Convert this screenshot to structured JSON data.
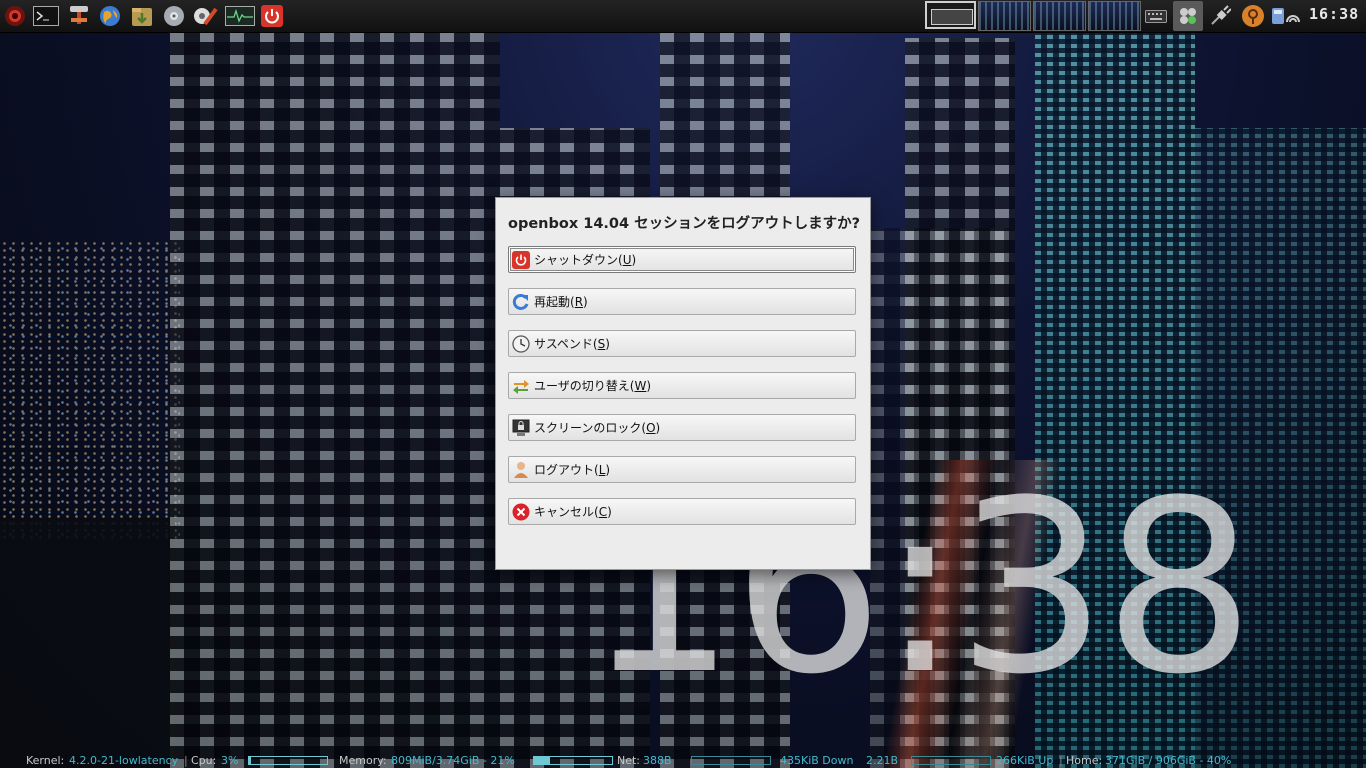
{
  "desktop": {
    "big_clock": "16:38"
  },
  "top_panel": {
    "launchers": [
      {
        "name": "menu-icon",
        "color": "#c8322b"
      },
      {
        "name": "terminal-icon",
        "color": "#333333"
      },
      {
        "name": "network-tools-icon",
        "color": "#c24a2a"
      },
      {
        "name": "web-browser-icon",
        "color": "#3d7bd0"
      },
      {
        "name": "file-manager-icon",
        "color": "#b99a52"
      },
      {
        "name": "disk-icon",
        "color": "#9aa0a8"
      },
      {
        "name": "settings-icon",
        "color": "#d24a2a"
      },
      {
        "name": "system-monitor-icon",
        "color": "#2d6a4a"
      },
      {
        "name": "power-icon",
        "color": "#d9342a"
      }
    ],
    "clock": "16:38"
  },
  "dialog": {
    "title": "openbox 14.04 セッションをログアウトしますか?",
    "options": [
      {
        "name": "shutdown",
        "label": "シャットダウン(",
        "mnemonic": "U",
        "suffix": ")",
        "icon": "power-icon",
        "color": "#d9342a"
      },
      {
        "name": "restart",
        "label": "再起動(",
        "mnemonic": "R",
        "suffix": ")",
        "icon": "restart-icon",
        "color": "#3a7bd5"
      },
      {
        "name": "suspend",
        "label": "サスペンド(",
        "mnemonic": "S",
        "suffix": ")",
        "icon": "clock-icon",
        "color": "#666666"
      },
      {
        "name": "switch-user",
        "label": "ユーザの切り替え(",
        "mnemonic": "W",
        "suffix": ")",
        "icon": "switch-user-icon",
        "color": "#e0932a"
      },
      {
        "name": "lock-screen",
        "label": "スクリーンのロック(",
        "mnemonic": "O",
        "suffix": ")",
        "icon": "lock-screen-icon",
        "color": "#444444"
      },
      {
        "name": "logout",
        "label": "ログアウト(",
        "mnemonic": "L",
        "suffix": ")",
        "icon": "logout-icon",
        "color": "#d98a4a"
      },
      {
        "name": "cancel",
        "label": "キャンセル(",
        "mnemonic": "C",
        "suffix": ")",
        "icon": "cancel-icon",
        "color": "#d8232a"
      }
    ]
  },
  "conky": {
    "kernel_label": "Kernel:",
    "kernel_value": "4.2.0-21-lowlatency",
    "cpu_label": "Cpu:",
    "cpu_value": "3%",
    "cpu_fraction": 0.03,
    "memory_label": "Memory:",
    "memory_value": "809MiB/3.74GiB - 21%",
    "memory_fraction": 0.21,
    "net_label": "Net:",
    "net_value": "388B",
    "down_value": "435KiB Down",
    "down_extra": "2.21B",
    "up_value": "266KiB Up",
    "home_label": "Home:",
    "home_value": "371GiB  / 906GiB - 40%",
    "home_fraction": 0.4
  }
}
